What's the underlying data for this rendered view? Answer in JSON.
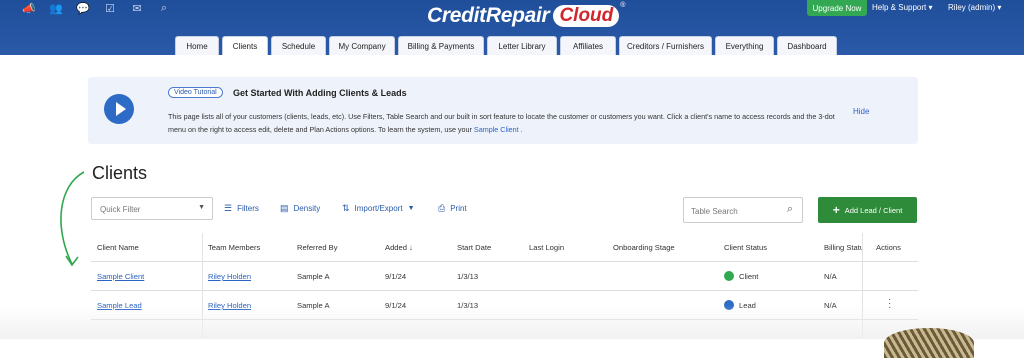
{
  "header": {
    "icons": [
      "megaphone-icon",
      "people-icon",
      "chat-icon",
      "check-icon",
      "mail-icon",
      "search-icon"
    ],
    "logo_main": "CreditRepair",
    "logo_cloud": "Cloud",
    "logo_reg": "®",
    "upgrade": "Upgrade Now",
    "help": "Help & Support ▾",
    "user": "Riley (admin) ▾"
  },
  "nav": {
    "tabs": [
      {
        "label": "Home"
      },
      {
        "label": "Clients"
      },
      {
        "label": "Schedule"
      },
      {
        "label": "My Company"
      },
      {
        "label": "Billing & Payments"
      },
      {
        "label": "Letter Library"
      },
      {
        "label": "Affiliates"
      },
      {
        "label": "Creditors / Furnishers"
      },
      {
        "label": "Everything"
      },
      {
        "label": "Dashboard"
      }
    ],
    "active_index": 1
  },
  "banner": {
    "tag": "Video Tutorial",
    "title": "Get Started With Adding Clients & Leads",
    "text_1": "This page lists all of your customers (clients, leads, etc). Use Filters, Table Search and our built in sort feature to locate the customer or customers you want. Click a client's name to access records and the 3-dot menu on the right to access edit, delete and Plan Actions options. To learn the system, use your",
    "text_link": "Sample Client",
    "text_end": ".",
    "hide": "Hide"
  },
  "page_title": "Clients",
  "toolbar": {
    "quick_filter_placeholder": "Quick Filter",
    "filters": "Filters",
    "density": "Density",
    "import_export": "Import/Export",
    "print": "Print",
    "search_placeholder": "Table Search",
    "add_button": "Add Lead / Client"
  },
  "table": {
    "columns": [
      "Client Name",
      "Team Members",
      "Referred By",
      "Added ↓",
      "Start Date",
      "Last Login",
      "Onboarding Stage",
      "Client Status",
      "Billing Statu",
      "Actions"
    ],
    "rows": [
      {
        "name": "Sample Client",
        "team": "Riley Holden",
        "referred": "Sample A",
        "added": "9/1/24",
        "start": "1/3/13",
        "login": "",
        "stage": "",
        "status": "Client",
        "status_color": "#2fa84f",
        "billing": "N/A"
      },
      {
        "name": "Sample Lead",
        "team": "Riley Holden",
        "referred": "Sample A",
        "added": "9/1/24",
        "start": "1/3/13",
        "login": "",
        "stage": "",
        "status": "Lead",
        "status_color": "#2d6bc7",
        "billing": "N/A"
      }
    ]
  },
  "colors": {
    "header_bg": "#1f4e9a",
    "accent_green": "#2e8b3a",
    "link_blue": "#2a63c4"
  }
}
